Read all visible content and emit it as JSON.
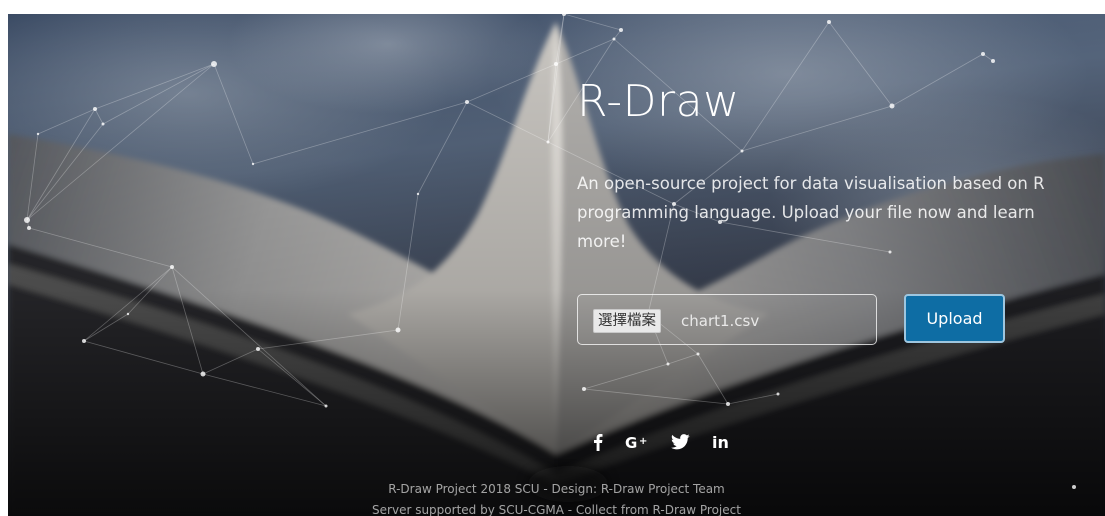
{
  "hero": {
    "title": "R-Draw",
    "description": "An open-source project for data visualisation based on R programming language. Upload your file now and learn more!"
  },
  "upload_form": {
    "choose_file_label": "選擇檔案",
    "selected_file": "chart1.csv",
    "upload_label": "Upload"
  },
  "social": [
    {
      "name": "facebook-icon",
      "glyph": "f"
    },
    {
      "name": "google-plus-icon",
      "glyph": "G+"
    },
    {
      "name": "twitter-icon",
      "glyph": "twitter"
    },
    {
      "name": "linkedin-icon",
      "glyph": "in"
    }
  ],
  "footer": {
    "line1": "R-Draw Project 2018 SCU - Design: R-Draw Project Team",
    "line2": "Server supported by SCU-CGMA - Collect from R-Draw Project"
  },
  "colors": {
    "upload_button": "#0e6da4",
    "upload_border": "#9ec6df",
    "text": "#ffffff"
  }
}
